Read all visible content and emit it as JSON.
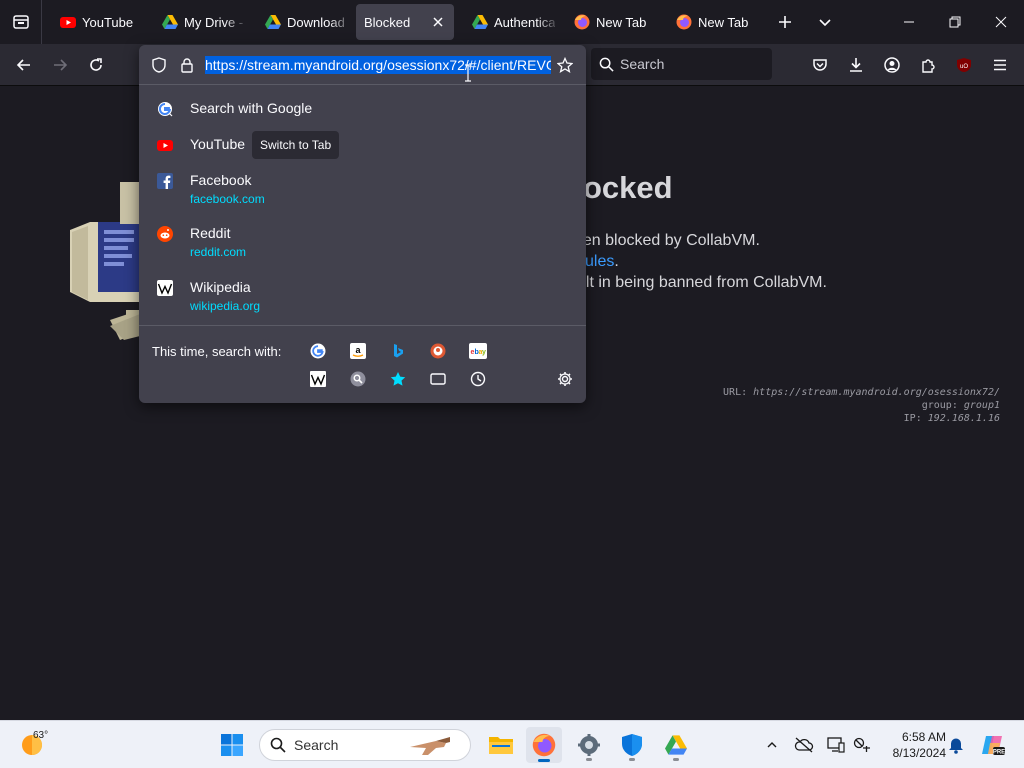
{
  "tabs": [
    {
      "title": "YouTube",
      "icon": "youtube-icon"
    },
    {
      "title": "My Drive -",
      "icon": "google-drive-icon"
    },
    {
      "title": "Download",
      "icon": "google-drive-icon"
    },
    {
      "title": "Blocked",
      "icon": "none",
      "active": true
    },
    {
      "title": "Authentica",
      "icon": "google-drive-icon"
    },
    {
      "title": "New Tab",
      "icon": "firefox-icon"
    },
    {
      "title": "New Tab",
      "icon": "firefox-icon"
    }
  ],
  "toolbar": {
    "url": "https://stream.myandroid.org/osessionx72/#/client/REVG",
    "search_placeholder": "Search"
  },
  "url_dropdown": {
    "results": [
      {
        "title": "Search with Google",
        "url": "",
        "icon": "google-icon"
      },
      {
        "title": "YouTube",
        "url": "",
        "icon": "youtube-icon",
        "action": "Switch to Tab"
      },
      {
        "title": "Facebook",
        "url": "facebook.com",
        "icon": "facebook-icon"
      },
      {
        "title": "Reddit",
        "url": "reddit.com",
        "icon": "reddit-icon"
      },
      {
        "title": "Wikipedia",
        "url": "wikipedia.org",
        "icon": "wikipedia-icon"
      }
    ],
    "one_off_label": "This time, search with:",
    "engines": [
      "google-icon",
      "amazon-icon",
      "bing-icon",
      "duckduckgo-icon",
      "ebay-icon",
      "wikipedia-icon",
      "search-icon",
      "bookmarks-star-icon",
      "tabs-icon",
      "history-icon"
    ]
  },
  "page": {
    "title_fragment": "ocked",
    "line1": "een blocked by CollabVM.",
    "line2_link": "ules",
    "line2_rest": ".",
    "line3": "ult in being banned from CollabVM.",
    "vm_url_label": "URL:",
    "vm_url": "https://stream.myandroid.org/osessionx72/",
    "vm_group_label": "group:",
    "vm_group": "group1",
    "vm_ip_label": "IP:",
    "vm_ip": "192.168.1.16"
  },
  "taskbar": {
    "weather_temp": "63°",
    "search_label": "Search",
    "time": "6:58 AM",
    "date": "8/13/2024"
  },
  "colors": {
    "accent_blue": "#0061e0",
    "link_cyan": "#00ddff",
    "panel": "#42414d",
    "toolbar": "#2b2a33",
    "page_bg": "#1c1b22"
  }
}
